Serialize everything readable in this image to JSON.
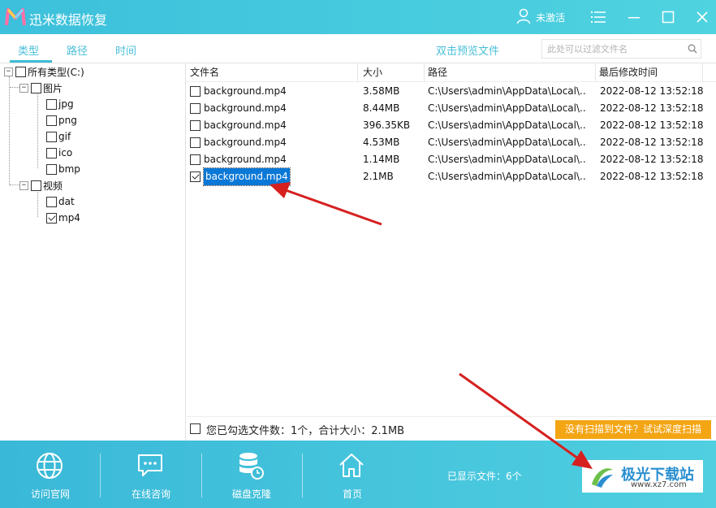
{
  "app": {
    "title": "迅米数据恢复",
    "user_label": "未激活"
  },
  "tabs": [
    {
      "label": "类型"
    },
    {
      "label": "路径"
    },
    {
      "label": "时间"
    }
  ],
  "preview_link": "双击预览文件",
  "filter": {
    "placeholder": "此处可以过滤文件名"
  },
  "tree": {
    "root": "所有类型(C:)",
    "groups": [
      {
        "label": "图片",
        "items": [
          "jpg",
          "png",
          "gif",
          "ico",
          "bmp"
        ]
      },
      {
        "label": "视频",
        "items": [
          "dat",
          "mp4"
        ]
      }
    ],
    "checked": [
      "mp4"
    ]
  },
  "table": {
    "columns": [
      "文件名",
      "大小",
      "路径",
      "最后修改时间"
    ],
    "rows": [
      {
        "name": "background.mp4",
        "size": "3.58MB",
        "path": "C:\\Users\\admin\\AppData\\Local\\...",
        "modified": "2022-08-12 13:52:18",
        "checked": false
      },
      {
        "name": "background.mp4",
        "size": "8.44MB",
        "path": "C:\\Users\\admin\\AppData\\Local\\...",
        "modified": "2022-08-12 13:52:18",
        "checked": false
      },
      {
        "name": "background.mp4",
        "size": "396.35KB",
        "path": "C:\\Users\\admin\\AppData\\Local\\...",
        "modified": "2022-08-12 13:52:18",
        "checked": false
      },
      {
        "name": "background.mp4",
        "size": "4.53MB",
        "path": "C:\\Users\\admin\\AppData\\Local\\...",
        "modified": "2022-08-12 13:52:18",
        "checked": false
      },
      {
        "name": "background.mp4",
        "size": "1.14MB",
        "path": "C:\\Users\\admin\\AppData\\Local\\...",
        "modified": "2022-08-12 13:52:18",
        "checked": false
      },
      {
        "name": "background.mp4",
        "size": "2.1MB",
        "path": "C:\\Users\\admin\\AppData\\Local\\...",
        "modified": "2022-08-12 13:52:18",
        "checked": true
      }
    ]
  },
  "status": {
    "selection_text": "您已勾选文件数：1个，合计大小：2.1MB",
    "deep_scan_label": "没有扫描到文件？试试深度扫描"
  },
  "toolbar": {
    "items": [
      {
        "label": "访问官网",
        "icon": "globe-icon"
      },
      {
        "label": "在线咨询",
        "icon": "chat-icon"
      },
      {
        "label": "磁盘克隆",
        "icon": "disk-clone-icon"
      },
      {
        "label": "首页",
        "icon": "home-icon"
      }
    ],
    "shown_count": "已显示文件：6个"
  },
  "watermark": {
    "text": "极光下载站",
    "url": "www.xz7.com"
  },
  "colors": {
    "accent": "#3fbcd6",
    "selection": "#0a78d7",
    "deep_scan": "#f3a514",
    "arrow": "#d62020"
  }
}
